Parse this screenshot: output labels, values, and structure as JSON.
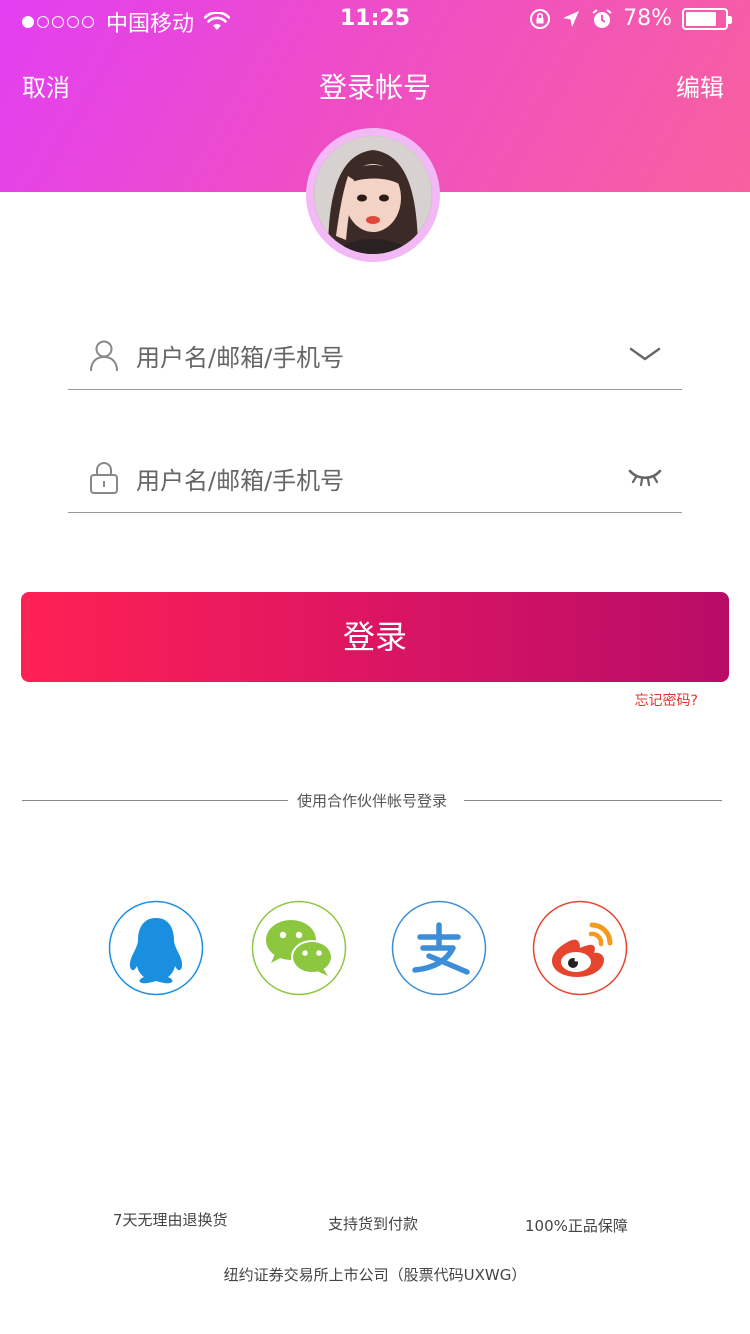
{
  "status_bar": {
    "carrier": "中国移动",
    "time": "11:25",
    "battery_text": "78%",
    "battery_level": 0.78,
    "icons": [
      "signal-dots",
      "wifi-icon",
      "orientation-lock-icon",
      "location-icon",
      "alarm-icon",
      "battery-icon"
    ]
  },
  "nav": {
    "cancel_label": "取消",
    "title": "登录帐号",
    "edit_label": "编辑"
  },
  "form": {
    "username_placeholder": "用户名/邮箱/手机号",
    "password_placeholder": "用户名/邮箱/手机号",
    "icons": [
      "user-icon",
      "chevron-down-icon",
      "lock-icon",
      "eye-closed-icon"
    ]
  },
  "login_button_label": "登录",
  "forgot_label": "忘记密码?",
  "partner_label": "使用合作伙伴帐号登录",
  "social": [
    {
      "name": "QQ",
      "icon": "qq-icon",
      "color": "#1a8fe0"
    },
    {
      "name": "WeChat",
      "icon": "wechat-icon",
      "color": "#8dc63f"
    },
    {
      "name": "Alipay",
      "icon": "alipay-icon",
      "color": "#3d8ed8"
    },
    {
      "name": "Weibo",
      "icon": "weibo-icon",
      "color": "#e6442d"
    }
  ],
  "guarantees": [
    "7天无理由退换货",
    "支持货到付款",
    "100%正品保障"
  ],
  "footer_text": "纽约证券交易所上市公司（股票代码UXWG）",
  "colors": {
    "header_start": "#e23ff2",
    "header_end": "#f7619f",
    "button_start": "#ff2153",
    "button_end": "#b80c67",
    "forgot": "#e5352f"
  }
}
